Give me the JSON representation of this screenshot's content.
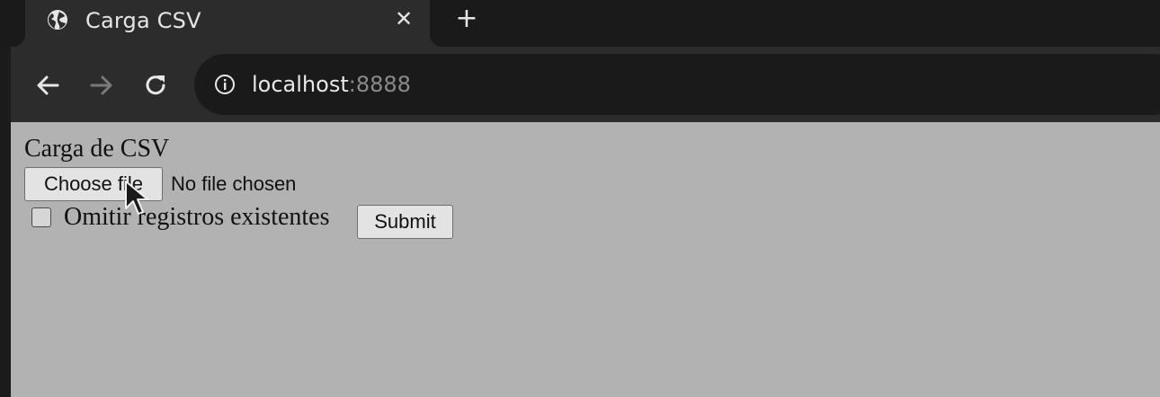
{
  "tab": {
    "title": "Carga CSV",
    "favicon": "globe-icon",
    "close_symbol": "✕",
    "new_tab_symbol": "+"
  },
  "toolbar": {
    "back_icon": "arrow-left-icon",
    "forward_icon": "arrow-right-icon",
    "reload_icon": "reload-icon",
    "info_icon": "info-icon",
    "url_host": "localhost",
    "url_port": ":8888"
  },
  "page": {
    "title": "Carga de CSV",
    "file_button_label": "Choose file",
    "file_status": "No file chosen",
    "checkbox_label": "Omitir registros existentes",
    "checkbox_checked": false,
    "submit_label": "Submit"
  },
  "colors": {
    "tab_strip": "#1a1a1a",
    "toolbar": "#2c2c2c",
    "omnibox": "#1a1a1a",
    "page_background": "#b2b2b2",
    "button_background": "#e3e3e3"
  }
}
